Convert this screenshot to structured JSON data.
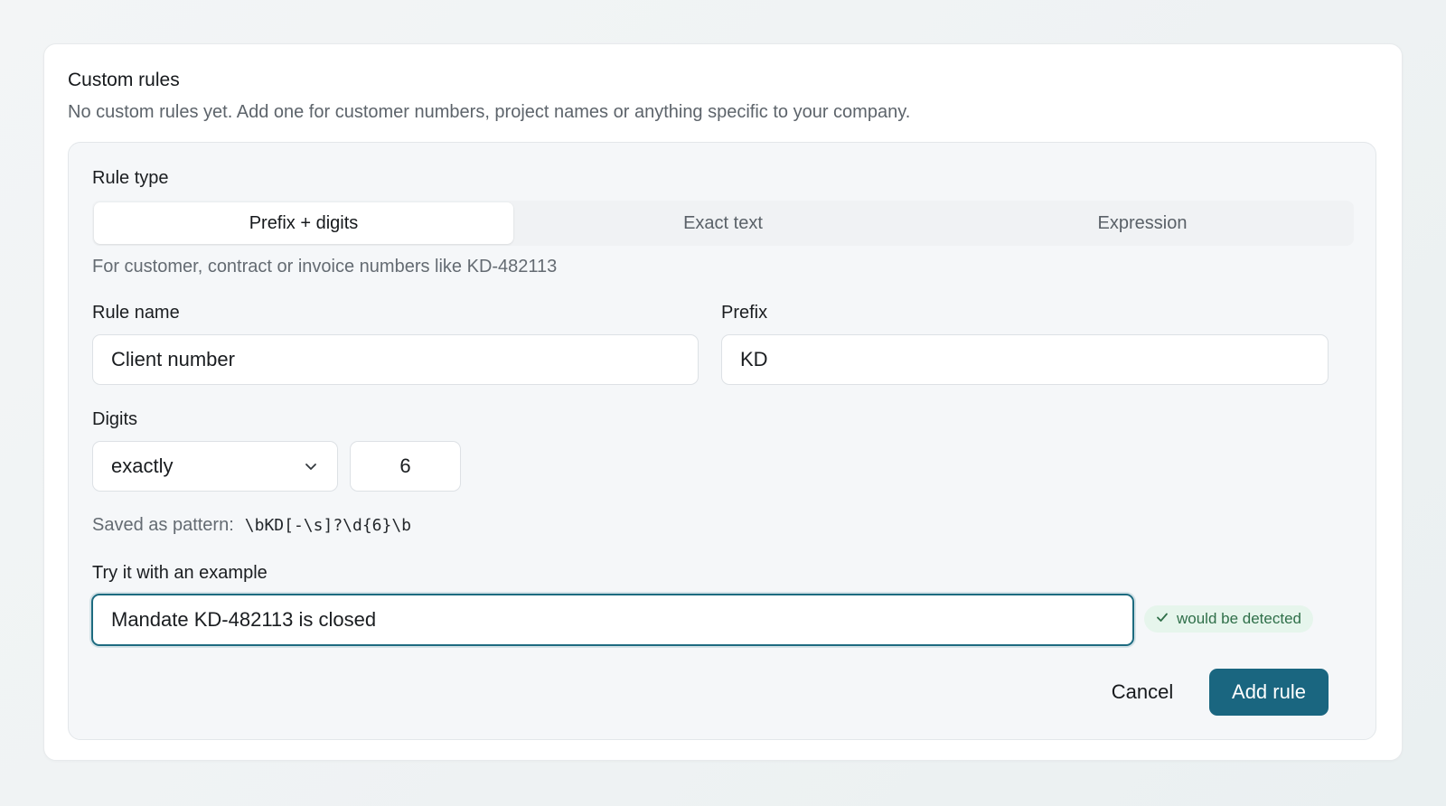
{
  "card": {
    "title": "Custom rules",
    "description": "No custom rules yet. Add one for customer numbers, project names or anything specific to your company."
  },
  "form": {
    "rule_type_label": "Rule type",
    "rule_types": [
      {
        "label": "Prefix + digits",
        "selected": true
      },
      {
        "label": "Exact text",
        "selected": false
      },
      {
        "label": "Expression",
        "selected": false
      }
    ],
    "rule_type_hint": "For customer, contract or invoice numbers like KD-482113",
    "rule_name_label": "Rule name",
    "rule_name_value": "Client number",
    "prefix_label": "Prefix",
    "prefix_value": "KD",
    "digits_label": "Digits",
    "digits_mode": "exactly",
    "digits_count": "6",
    "pattern_label": "Saved as pattern:",
    "pattern_value": "\\bKD[-\\s]?\\d{6}\\b",
    "example_label": "Try it with an example",
    "example_value": "Mandate KD-482113 is closed",
    "match_status": "would be detected",
    "cancel_label": "Cancel",
    "submit_label": "Add rule"
  },
  "colors": {
    "accent": "#1a6680",
    "success_bg": "#e6f5ec",
    "success_text": "#2f6f49"
  },
  "icons": {
    "digits_dropdown": "chevron-down-icon",
    "match_status": "check-icon"
  }
}
